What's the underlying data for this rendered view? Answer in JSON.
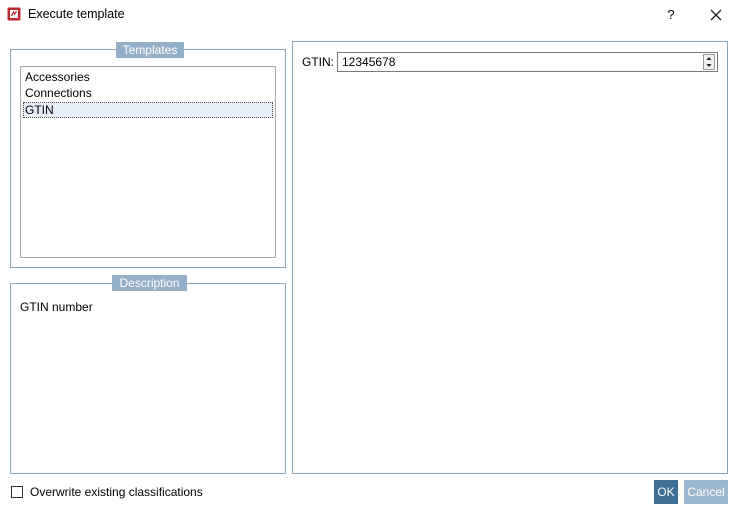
{
  "window": {
    "title": "Execute template",
    "help_label": "?",
    "accent": "#c0262d"
  },
  "templates": {
    "group_label": "Templates",
    "items": [
      {
        "label": "Accessories"
      },
      {
        "label": "Connections"
      },
      {
        "label": "GTIN"
      }
    ],
    "selected": "GTIN"
  },
  "description": {
    "group_label": "Description",
    "text": "GTIN number"
  },
  "form": {
    "gtin_label": "GTIN:",
    "gtin_value": "12345678"
  },
  "footer": {
    "overwrite_label": "Overwrite existing classifications",
    "overwrite_checked": false,
    "ok_label": "OK",
    "cancel_label": "Cancel"
  },
  "colors": {
    "group_border": "#8aa4b8",
    "group_label_bg": "#94b0c8",
    "ok_bg": "#3f6f94",
    "cancel_bg": "#9cb8cf",
    "selection_bg": "#e8eef7"
  }
}
